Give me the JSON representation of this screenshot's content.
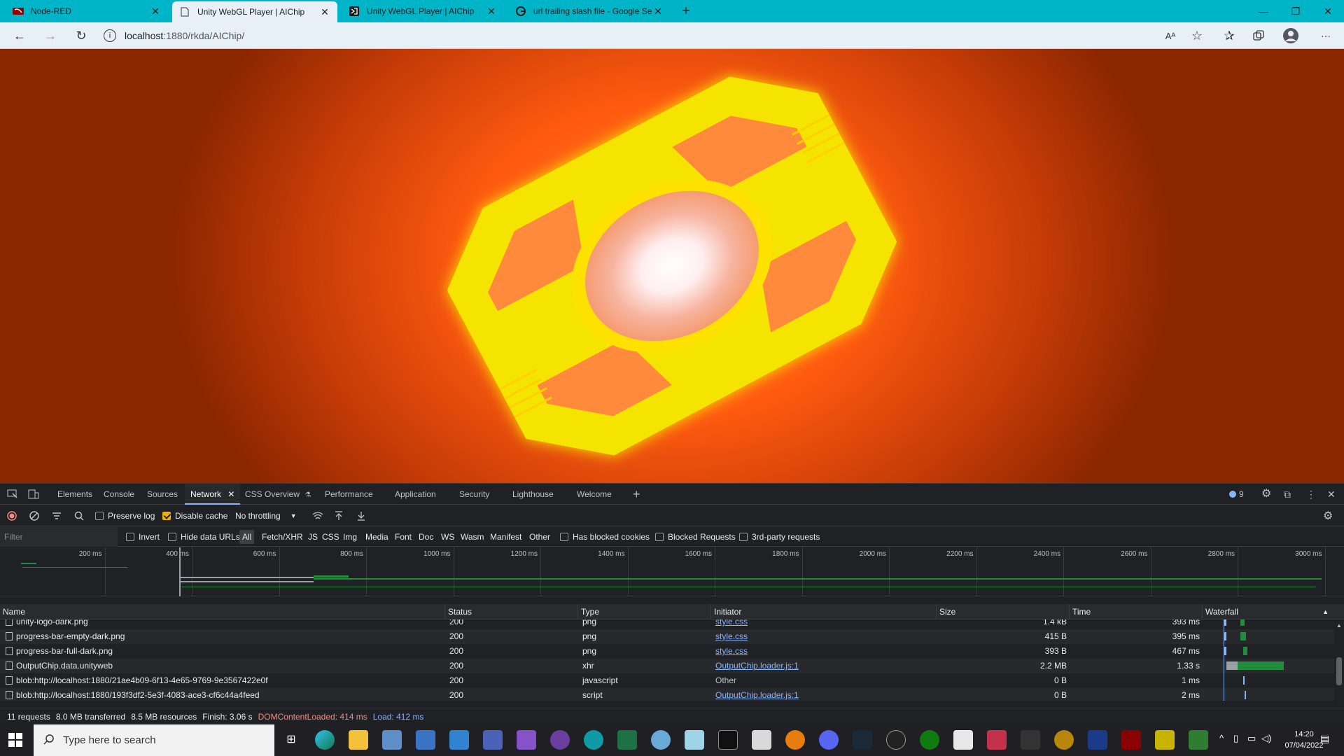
{
  "browser": {
    "tabs": [
      {
        "label": "Node-RED",
        "active": false
      },
      {
        "label": "Unity WebGL Player | AIChip",
        "active": true
      },
      {
        "label": "Unity WebGL Player | AIChip",
        "active": false
      },
      {
        "label": "url trailing slash file - Google Sea",
        "active": false
      }
    ],
    "new_tab": "+",
    "window_controls": {
      "minimize": "—",
      "restore": "❐",
      "close": "✕"
    },
    "address": {
      "host": "localhost",
      "path": ":1880/rkda/AIChip/"
    }
  },
  "devtools": {
    "tabs": [
      "Elements",
      "Console",
      "Sources",
      "Network",
      "CSS Overview",
      "Performance",
      "Application",
      "Security",
      "Lighthouse",
      "Welcome"
    ],
    "active_tab": "Network",
    "issues_count": "9",
    "toolbar": {
      "preserve_log": "Preserve log",
      "disable_cache": "Disable cache",
      "throttling": "No throttling"
    },
    "filter": {
      "placeholder": "Filter",
      "invert": "Invert",
      "hide_data_urls": "Hide data URLs",
      "types": [
        "All",
        "Fetch/XHR",
        "JS",
        "CSS",
        "Img",
        "Media",
        "Font",
        "Doc",
        "WS",
        "Wasm",
        "Manifest",
        "Other"
      ],
      "selected_type": "All",
      "has_blocked_cookies": "Has blocked cookies",
      "blocked_requests": "Blocked Requests",
      "third_party": "3rd-party requests"
    },
    "overview_ticks": [
      "200 ms",
      "400 ms",
      "600 ms",
      "800 ms",
      "1000 ms",
      "1200 ms",
      "1400 ms",
      "1600 ms",
      "1800 ms",
      "2000 ms",
      "2200 ms",
      "2400 ms",
      "2600 ms",
      "2800 ms",
      "3000 ms"
    ],
    "columns": [
      "Name",
      "Status",
      "Type",
      "Initiator",
      "Size",
      "Time",
      "Waterfall"
    ],
    "rows": [
      {
        "name": "unity-logo-dark.png",
        "status": "200",
        "type": "png",
        "initiator": "style.css",
        "size": "1.4 kB",
        "time": "393 ms",
        "initiator_link": true
      },
      {
        "name": "progress-bar-empty-dark.png",
        "status": "200",
        "type": "png",
        "initiator": "style.css",
        "size": "415 B",
        "time": "395 ms",
        "initiator_link": true
      },
      {
        "name": "progress-bar-full-dark.png",
        "status": "200",
        "type": "png",
        "initiator": "style.css",
        "size": "393 B",
        "time": "467 ms",
        "initiator_link": true
      },
      {
        "name": "OutputChip.data.unityweb",
        "status": "200",
        "type": "xhr",
        "initiator": "OutputChip.loader.js:1",
        "size": "2.2 MB",
        "time": "1.33 s",
        "initiator_link": true
      },
      {
        "name": "blob:http://localhost:1880/21ae4b09-6f13-4e65-9769-9e3567422e0f",
        "status": "200",
        "type": "javascript",
        "initiator": "Other",
        "size": "0 B",
        "time": "1 ms",
        "initiator_link": false
      },
      {
        "name": "blob:http://localhost:1880/193f3df2-5e3f-4083-ace3-cf6c44a4feed",
        "status": "200",
        "type": "script",
        "initiator": "OutputChip.loader.js:1",
        "size": "0 B",
        "time": "2 ms",
        "initiator_link": true
      }
    ],
    "status_bar": {
      "requests": "11 requests",
      "transferred": "8.0 MB transferred",
      "resources": "8.5 MB resources",
      "finish": "Finish: 3.06 s",
      "dcl": "DOMContentLoaded: 414 ms",
      "load": "Load: 412 ms"
    }
  },
  "taskbar": {
    "search_placeholder": "Type here to search",
    "time": "14:20",
    "date": "07/04/2022"
  },
  "colors": {
    "tabbar": "#00b4c8",
    "chip_glow": "#ffe000",
    "dcl": "#f28b82",
    "load": "#8ab4f8"
  }
}
